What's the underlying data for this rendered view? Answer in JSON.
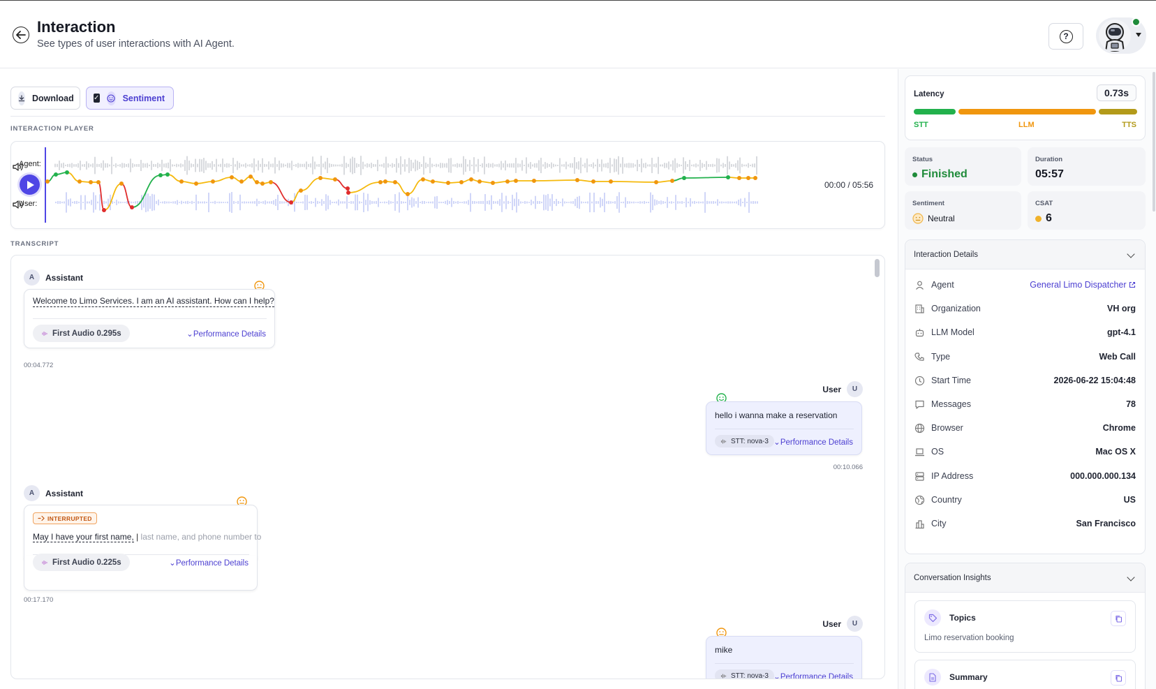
{
  "header": {
    "title": "Interaction",
    "subtitle": "See types of user interactions with AI Agent."
  },
  "toolbar": {
    "download_label": "Download",
    "sentiment_label": "Sentiment",
    "sentiment_checked": true
  },
  "player": {
    "section_label": "INTERACTION PLAYER",
    "agent_label": "Agent:",
    "user_label": "User:",
    "time": "00:00 / 05:56"
  },
  "transcript": {
    "section_label": "TRANSCRIPT",
    "messages": [
      {
        "role": "Assistant",
        "avatar": "A",
        "text": "Welcome to Limo Services. I am an AI assistant. How can I help?",
        "chip": "First Audio 0.295s",
        "perf": "Performance Details",
        "timestamp": "00:04.772",
        "sentiment": "neutral"
      },
      {
        "role": "User",
        "avatar": "U",
        "text": "hello i wanna make a reservation",
        "chip": "STT: nova-3",
        "perf": "Performance Details",
        "timestamp": "00:10.066",
        "sentiment": "positive"
      },
      {
        "role": "Assistant",
        "avatar": "A",
        "badge": "INTERRUPTED",
        "text": "May I have your first name,",
        "text_cut": "last name, and phone number to",
        "chip": "First Audio 0.225s",
        "perf": "Performance Details",
        "timestamp": "00:17.170",
        "sentiment": "neutral"
      },
      {
        "role": "User",
        "avatar": "U",
        "text": "mike",
        "chip": "STT: nova-3",
        "perf": "Performance Details",
        "sentiment": "neutral"
      }
    ]
  },
  "latency": {
    "title": "Latency",
    "value": "0.73s",
    "segments": [
      {
        "label": "STT",
        "color": "#22b14c"
      },
      {
        "label": "LLM",
        "color": "#f0960e"
      },
      {
        "label": "TTS",
        "color": "#b39a1a"
      }
    ]
  },
  "stats": {
    "status_label": "Status",
    "status_value": "Finished",
    "duration_label": "Duration",
    "duration_value": "05:57",
    "sentiment_label": "Sentiment",
    "sentiment_value": "Neutral",
    "csat_label": "CSAT",
    "csat_value": "6"
  },
  "details": {
    "title": "Interaction Details",
    "rows": [
      {
        "icon": "user-icon",
        "key": "Agent",
        "value": "General Limo Dispatcher"
      },
      {
        "icon": "building-icon",
        "key": "Organization",
        "value": "VH org"
      },
      {
        "icon": "bot-icon",
        "key": "LLM Model",
        "value": "gpt-4.1"
      },
      {
        "icon": "phone-icon",
        "key": "Type",
        "value": "Web Call"
      },
      {
        "icon": "clock-icon",
        "key": "Start Time",
        "value": "2026-06-22 15:04:48"
      },
      {
        "icon": "message-icon",
        "key": "Messages",
        "value": "78"
      },
      {
        "icon": "globe-icon",
        "key": "Browser",
        "value": "Chrome"
      },
      {
        "icon": "laptop-icon",
        "key": "OS",
        "value": "Mac OS X"
      },
      {
        "icon": "server-icon",
        "key": "IP Address",
        "value": "000.000.000.134"
      },
      {
        "icon": "earth-icon",
        "key": "Country",
        "value": "US"
      },
      {
        "icon": "city-icon",
        "key": "City",
        "value": "San Francisco"
      }
    ]
  },
  "insights": {
    "title": "Conversation Insights",
    "topics_title": "Topics",
    "topics_text": "Limo reservation booking",
    "summary_title": "Summary"
  }
}
